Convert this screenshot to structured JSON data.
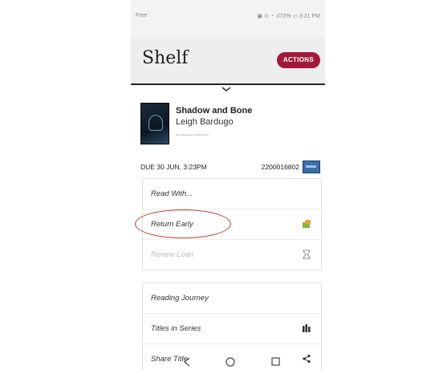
{
  "status": {
    "carrier": "Free",
    "right": "▣ ⊙ ◔ .ıl73% ▭ 3:21 PM"
  },
  "appbar": {
    "title": "Shelf",
    "actions_label": "ACTIONS"
  },
  "book": {
    "title": "Shadow and Bone",
    "author": "Leigh Bardugo",
    "small_text": "Recommended by Brian Smith"
  },
  "loan": {
    "due": "DUE 30 JUN, 3:23PM",
    "card_number": "2200016802"
  },
  "menu1": {
    "items": [
      {
        "label": "Read With...",
        "icon": ""
      },
      {
        "label": "Return Early",
        "icon": "return-icon"
      },
      {
        "label": "Renew Loan",
        "icon": "hourglass-icon"
      }
    ]
  },
  "menu2": {
    "items": [
      {
        "label": "Reading Journey",
        "icon": ""
      },
      {
        "label": "Titles in Series",
        "icon": "books-icon"
      },
      {
        "label": "Share Title",
        "icon": "share-icon"
      }
    ]
  },
  "colors": {
    "accent": "#a3183a",
    "annotation": "#c0392b",
    "card": "#3b6fa8"
  }
}
